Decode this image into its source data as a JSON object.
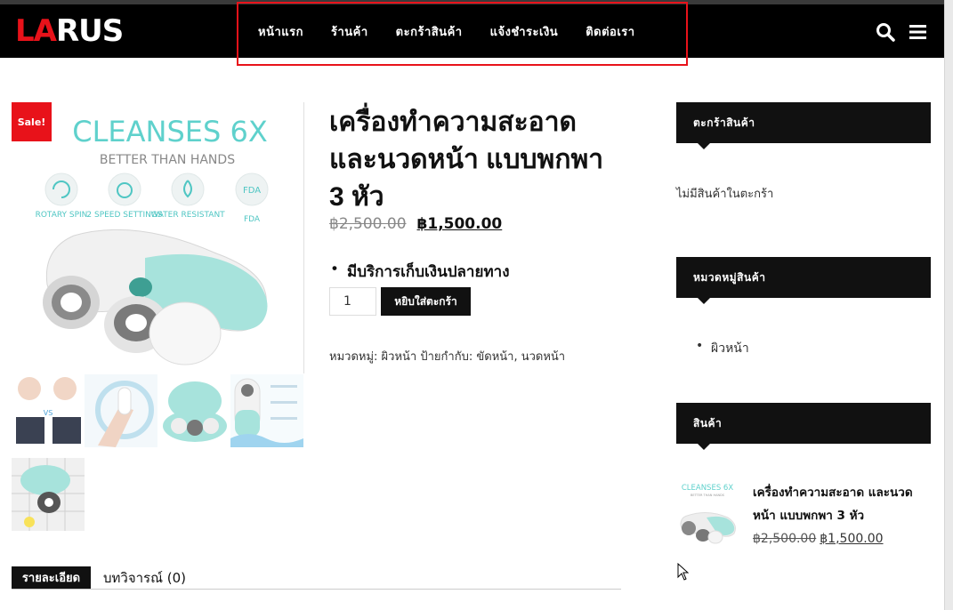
{
  "brand": {
    "logo_red": "LA",
    "logo_white": "RUS",
    "accent_color": "#e8121a"
  },
  "nav": {
    "items": [
      "หน้าแรก",
      "ร้านค้า",
      "ตะกร้าสินค้า",
      "แจ้งชำระเงิน",
      "ติดต่อเรา"
    ],
    "icons": [
      "search-icon",
      "hamburger-menu-icon"
    ]
  },
  "product": {
    "sale_badge": "Sale!",
    "title": "เครื่องทำความสะอาด และนวดหน้า แบบพกพา 3 หัว",
    "old_price": "฿2,500.00",
    "new_price": "฿1,500.00",
    "cod_note": "มีบริการเก็บเงินปลายทาง",
    "quantity": "1",
    "add_to_cart": "หยิบใส่ตะกร้า",
    "meta_category_label": "หมวดหมู่:",
    "meta_category": "ผิวหน้า",
    "meta_tags_label": "ป้ายกำกับ:",
    "meta_tags": "ขัดหน้า, นวดหน้า",
    "image_text": {
      "headline": "CLEANSES 6X",
      "subline": "BETTER THAN HANDS",
      "features": [
        "ROTARY SPIN",
        "2 SPEED SETTINGS",
        "WATER RESISTANT",
        "FDA"
      ]
    }
  },
  "tabs": {
    "description": "รายละเอียด",
    "reviews": "บทวิจารณ์ (0)"
  },
  "sidebar": {
    "cart": {
      "heading": "ตะกร้าสินค้า",
      "empty": "ไม่มีสินค้าในตะกร้า"
    },
    "categories": {
      "heading": "หมวดหมู่สินค้า",
      "items": [
        "ผิวหน้า"
      ]
    },
    "products": {
      "heading": "สินค้า",
      "item_title": "เครื่องทำความสะอาด และนวดหน้า แบบพกพา 3 หัว",
      "old_price": "฿2,500.00",
      "new_price": "฿1,500.00"
    }
  }
}
